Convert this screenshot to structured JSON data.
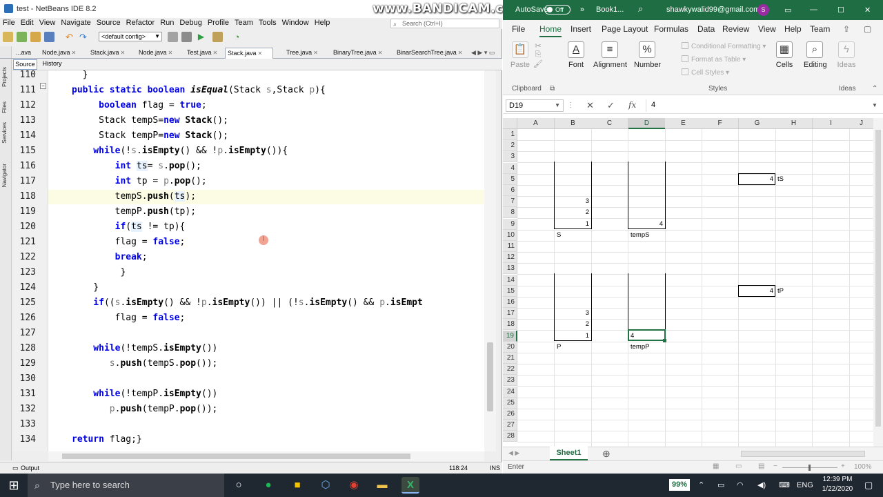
{
  "netbeans": {
    "title": "test - NetBeans IDE 8.2",
    "watermark": "www.BANDICAM.com",
    "menu": [
      "File",
      "Edit",
      "View",
      "Navigate",
      "Source",
      "Refactor",
      "Run",
      "Debug",
      "Profile",
      "Team",
      "Tools",
      "Window",
      "Help"
    ],
    "search_placeholder": "Search (Ctrl+I)",
    "config": "<default config>",
    "file_tabs": [
      "...ava",
      "Node.java",
      "Stack.java",
      "Node.java",
      "Test.java",
      "Stack.java",
      "Tree.java",
      "BinaryTree.java",
      "BinarSearchTree.java"
    ],
    "active_tab": 5,
    "source_tab": "Source",
    "history_tab": "History",
    "side_labels": [
      "Projects",
      "Files",
      "Services",
      "Navigator"
    ],
    "line_numbers": [
      "110",
      "111",
      "112",
      "113",
      "114",
      "115",
      "116",
      "117",
      "118",
      "119",
      "120",
      "121",
      "122",
      "123",
      "124",
      "125",
      "126",
      "127",
      "128",
      "129",
      "130",
      "131",
      "132",
      "133",
      "134"
    ],
    "status": {
      "output": "Output",
      "position": "118:24",
      "mode": "INS"
    }
  },
  "excel": {
    "autosave_label": "AutoSave",
    "autosave_state": "Off",
    "book_name": "Book1...",
    "user_email": "shawkywalid99@gmail.com",
    "avatar_letter": "S",
    "ribbon_tabs": [
      "File",
      "Home",
      "Insert",
      "Page Layout",
      "Formulas",
      "Data",
      "Review",
      "View",
      "Help",
      "Team"
    ],
    "active_tab": "Home",
    "groups": {
      "paste": "Paste",
      "clipboard": "Clipboard",
      "font": "Font",
      "alignment": "Alignment",
      "number": "Number",
      "cond_format": "Conditional Formatting",
      "format_table": "Format as Table",
      "cell_styles": "Cell Styles",
      "styles": "Styles",
      "cells": "Cells",
      "editing": "Editing",
      "ideas": "Ideas",
      "ideas_group": "Ideas"
    },
    "name_box": "D19",
    "formula_value": "4",
    "columns": [
      "A",
      "B",
      "C",
      "D",
      "E",
      "F",
      "G",
      "H",
      "I",
      "J"
    ],
    "rows": [
      "1",
      "2",
      "3",
      "4",
      "5",
      "6",
      "7",
      "8",
      "9",
      "10",
      "11",
      "12",
      "13",
      "14",
      "15",
      "16",
      "17",
      "18",
      "19",
      "20",
      "21",
      "22",
      "23",
      "24",
      "25",
      "26",
      "27",
      "28"
    ],
    "cells": {
      "B7": "3",
      "B8": "2",
      "B9": "1",
      "D9": "4",
      "B10": "S",
      "D10": "tempS",
      "G5": "4",
      "H5": "tS",
      "B17": "3",
      "B18": "2",
      "B19": "1",
      "D19": "4",
      "B20": "P",
      "D20": "tempP",
      "G15": "4",
      "H15": "tP"
    },
    "sheet_tab": "Sheet1",
    "status_mode": "Enter",
    "zoom": "100%",
    "accent": "#217346"
  },
  "taskbar": {
    "search_placeholder": "Type here to search",
    "battery": "99%",
    "language": "ENG",
    "time": "12:39 PM",
    "date": "1/22/2020"
  }
}
